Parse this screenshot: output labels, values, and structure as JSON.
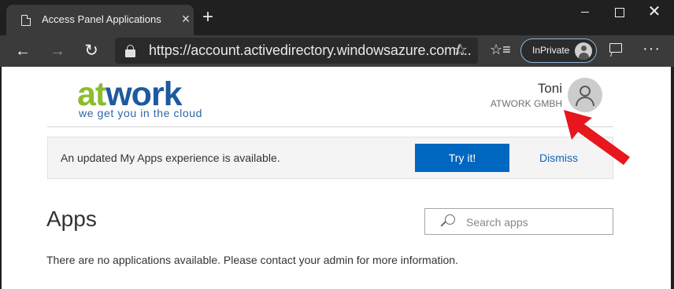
{
  "browser": {
    "tab_title": "Access Panel Applications",
    "url": "https://account.activedirectory.windowsazure.com/...",
    "inprivate_label": "InPrivate",
    "icons": {
      "tab_favicon": "page-icon",
      "tab_close": "close-icon",
      "new_tab": "plus-icon",
      "back": "arrow-left-icon",
      "forward": "arrow-right-icon",
      "refresh": "refresh-icon",
      "lock": "lock-icon",
      "favorite": "star-icon",
      "favorites_list": "favorites-list-icon",
      "feedback": "feedback-icon",
      "more": "more-icon"
    }
  },
  "header": {
    "logo_part1": "at",
    "logo_part2": "work",
    "logo_tagline": "we get you in the cloud",
    "user_name": "Toni",
    "user_org": "ATWORK GMBH"
  },
  "banner": {
    "text": "An updated My Apps experience is available.",
    "try_label": "Try it!",
    "dismiss_label": "Dismiss"
  },
  "main": {
    "heading": "Apps",
    "search_placeholder": "Search apps",
    "empty_message": "There are no applications available. Please contact your admin for more information."
  },
  "colors": {
    "logo_green": "#8bbd2c",
    "logo_blue": "#1d5a9e",
    "primary_button": "#0067c0",
    "link": "#0f66b8",
    "annotation_arrow": "#e8161d"
  }
}
